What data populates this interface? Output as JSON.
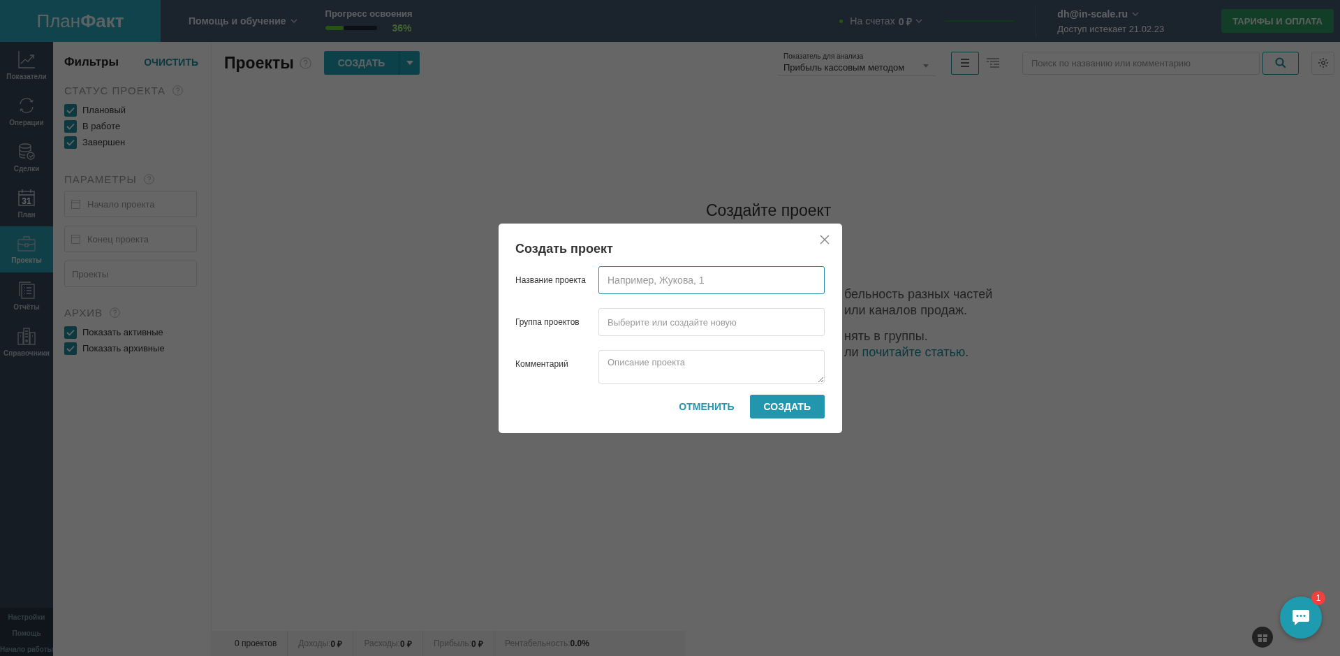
{
  "logo": "План**Факт**",
  "topbar": {
    "help_menu": "Помощь и обучение",
    "progress": {
      "label": "Прогресс освоения",
      "level": 0.36,
      "percent": "36%"
    },
    "balance": {
      "label": "На счетах",
      "amount": "0 ₽"
    },
    "user": {
      "email": "dh@in-scale.ru",
      "access": "Доступ истекает 21.02.23"
    },
    "plans_button": "ТАРИФЫ И ОПЛАТА"
  },
  "nav": {
    "items": [
      {
        "label": "Показатели",
        "selected": false
      },
      {
        "label": "Операции",
        "selected": false
      },
      {
        "label": "Сделки",
        "selected": false
      },
      {
        "label": "План",
        "icon_text": "31",
        "selected": false
      },
      {
        "label": "Проекты",
        "selected": true
      },
      {
        "label": "Отчёты",
        "selected": false
      },
      {
        "label": "Справочники",
        "selected": false
      }
    ],
    "footer": [
      "Настройки",
      "Помощь",
      "Начало работы"
    ]
  },
  "filters": {
    "title": "Фильтры",
    "clear": "ОЧИСТИТЬ",
    "status": {
      "title": "СТАТУС ПРОЕКТА",
      "options": [
        {
          "label": "Плановый",
          "checked": true
        },
        {
          "label": "В работе",
          "checked": true
        },
        {
          "label": "Завершен",
          "checked": true
        }
      ]
    },
    "params": {
      "title": "ПАРАМЕТРЫ",
      "fields": [
        {
          "kind": "date",
          "placeholder": "Начало проекта"
        },
        {
          "kind": "date",
          "placeholder": "Конец проекта"
        },
        {
          "kind": "text",
          "placeholder": "Проекты"
        }
      ]
    },
    "archive": {
      "title": "АРХИВ",
      "options": [
        {
          "label": "Показать активные",
          "checked": true
        },
        {
          "label": "Показать архивные",
          "checked": true
        }
      ]
    }
  },
  "toolbar": {
    "title": "Проекты",
    "create": "СОЗДАТЬ",
    "metric": {
      "label": "Показатель для анализа",
      "value": "Прибыль кассовым методом"
    },
    "views": [
      {
        "kind": "list",
        "selected": true
      },
      {
        "kind": "tree",
        "selected": false
      }
    ],
    "search": {
      "placeholder": "Поиск по названию или комментарию"
    }
  },
  "empty_state": {
    "title": "Создайте проект",
    "lines": [
      {
        "text": "бельность разных частей"
      },
      {
        "text": "или каналов продаж."
      },
      {
        "text": "нять в группы."
      },
      {
        "text": "ли ",
        "link": "почитайте статью",
        "after": "."
      }
    ]
  },
  "modal": {
    "title": "Создать проект",
    "fields": [
      {
        "kind": "input",
        "label": "Название проекта",
        "placeholder": "Например, Жукова, 1",
        "focused": true
      },
      {
        "kind": "input",
        "label": "Группа проектов",
        "placeholder": "Выберите или создайте новую",
        "focused": false
      },
      {
        "kind": "textarea",
        "label": "Комментарий",
        "placeholder": "Описание проекта",
        "focused": false
      }
    ],
    "cancel": "ОТМЕНИТЬ",
    "submit": "СОЗДАТЬ"
  },
  "summary": [
    {
      "label": "0 проектов"
    },
    {
      "label": "Доходы:",
      "value": "0 ₽"
    },
    {
      "label": "Расходы:",
      "value": "0 ₽"
    },
    {
      "label": "Прибыль:",
      "value": "0 ₽"
    },
    {
      "label": "Рентабельность:",
      "value": "0.0%"
    }
  ],
  "chat": {
    "badge": "1"
  }
}
